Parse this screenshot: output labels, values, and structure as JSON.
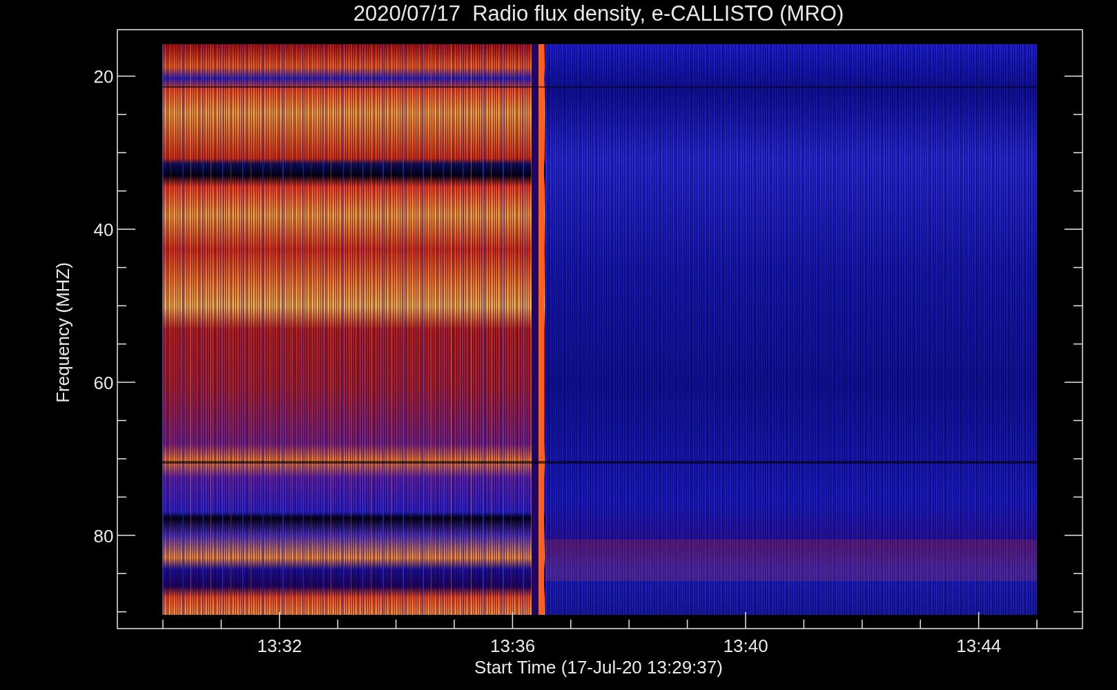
{
  "title": "2020/07/17  Radio flux density, e-CALLISTO (MRO)",
  "y_axis": {
    "label": "Frequency (MHZ)",
    "ticks": [
      "20",
      "40",
      "60",
      "80"
    ]
  },
  "x_axis": {
    "label": "Start Time (17-Jul-20 13:29:37)",
    "ticks": [
      "13:32",
      "13:36",
      "13:40",
      "13:44"
    ]
  }
}
